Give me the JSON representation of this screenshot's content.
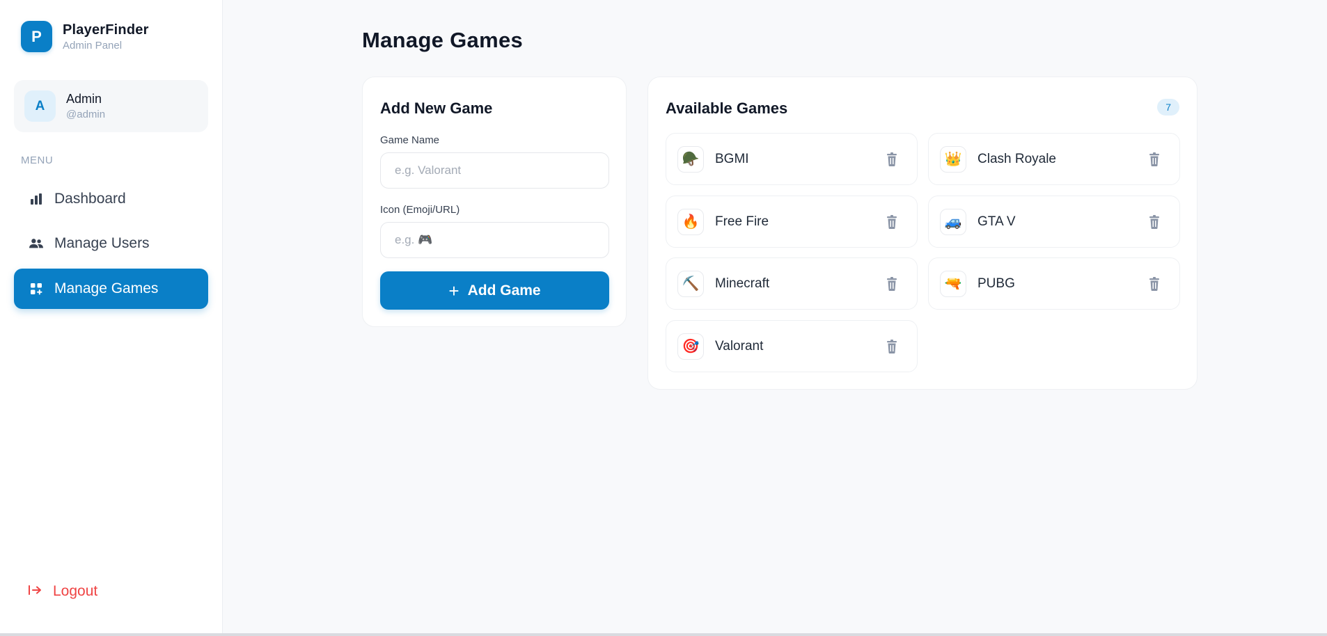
{
  "brand": {
    "logo_letter": "P",
    "name": "PlayerFinder",
    "subtitle": "Admin Panel"
  },
  "user": {
    "avatar_letter": "A",
    "name": "Admin",
    "handle": "@admin"
  },
  "sidebar": {
    "menu_label": "MENU",
    "items": [
      {
        "label": "Dashboard",
        "icon": "bar-chart-icon",
        "active": false
      },
      {
        "label": "Manage Users",
        "icon": "users-icon",
        "active": false
      },
      {
        "label": "Manage Games",
        "icon": "grid-plus-icon",
        "active": true
      }
    ],
    "logout_label": "Logout"
  },
  "page": {
    "title": "Manage Games"
  },
  "add_form": {
    "title": "Add New Game",
    "name_label": "Game Name",
    "name_placeholder": "e.g. Valorant",
    "icon_label": "Icon (Emoji/URL)",
    "icon_placeholder": "e.g. 🎮",
    "button_label": "Add Game"
  },
  "games_panel": {
    "title": "Available Games",
    "count": "7",
    "games": [
      {
        "name": "BGMI",
        "icon": "🪖"
      },
      {
        "name": "Clash Royale",
        "icon": "👑"
      },
      {
        "name": "Free Fire",
        "icon": "🔥"
      },
      {
        "name": "GTA V",
        "icon": "🚙"
      },
      {
        "name": "Minecraft",
        "icon": "⛏️"
      },
      {
        "name": "PUBG",
        "icon": "🔫"
      },
      {
        "name": "Valorant",
        "icon": "🎯"
      }
    ]
  },
  "colors": {
    "accent": "#0a7fc7",
    "danger": "#ef4444",
    "muted": "#94a3b8"
  }
}
